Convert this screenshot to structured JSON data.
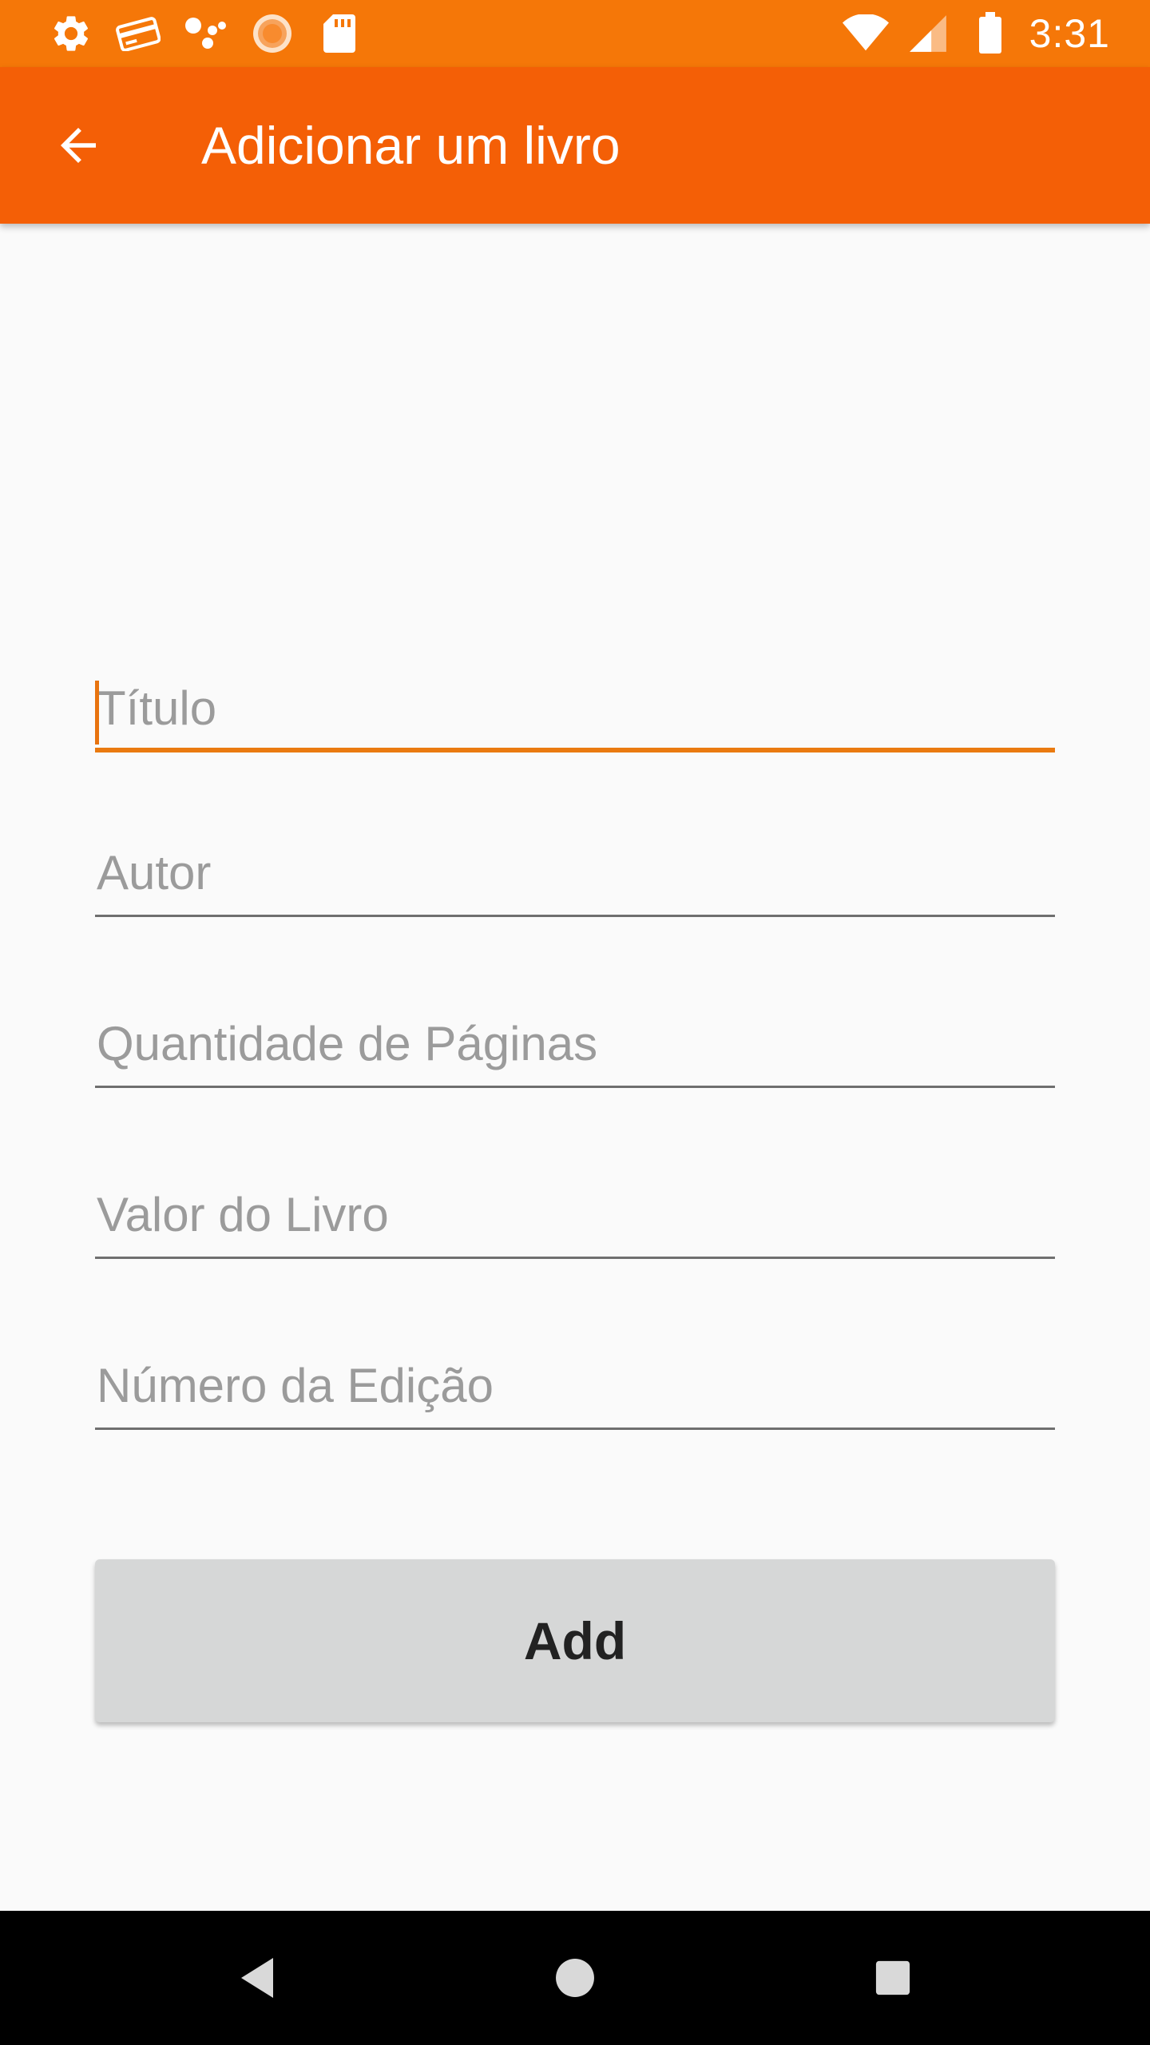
{
  "status_bar": {
    "time": "3:31",
    "left_icons": [
      "settings-icon",
      "card-icon",
      "assistant-icon",
      "sun-icon",
      "sd-card-icon"
    ],
    "right_icons": [
      "wifi-icon",
      "signal-icon",
      "battery-icon"
    ]
  },
  "app_bar": {
    "title": "Adicionar um livro",
    "back_icon": "arrow-back-icon",
    "background": "#f45f06"
  },
  "form": {
    "fields": [
      {
        "placeholder": "Título",
        "value": ""
      },
      {
        "placeholder": "Autor",
        "value": ""
      },
      {
        "placeholder": "Quantidade de Páginas",
        "value": ""
      },
      {
        "placeholder": "Valor do Livro",
        "value": ""
      },
      {
        "placeholder": "Número da Edição",
        "value": ""
      }
    ],
    "submit_label": "Add"
  },
  "nav_bar": {
    "buttons": [
      "back-nav-icon",
      "home-nav-icon",
      "recents-nav-icon"
    ]
  },
  "colors": {
    "status_bar": "#f57708",
    "app_bar": "#f45f06",
    "accent": "#ea7a10",
    "background": "#fafafa",
    "button": "#d6d7d7"
  }
}
